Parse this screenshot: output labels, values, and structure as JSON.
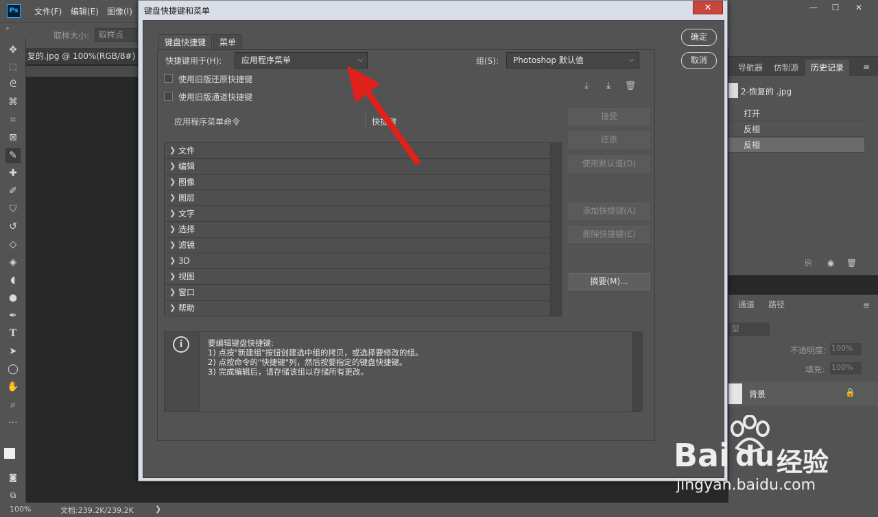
{
  "app": {
    "logo": "Ps",
    "menu": [
      "文件(F)",
      "编辑(E)",
      "图像(I)"
    ],
    "window_controls": {
      "min": "—",
      "max": "☐",
      "close": "✕"
    },
    "options": {
      "sample_size_label": "取样大小:",
      "sample_size_value": "取样点"
    },
    "doc_tab": "复的.jpg @ 100%(RGB/8#) *",
    "status": {
      "zoom": "100%",
      "doc": "文档:239.2K/239.2K",
      "arrow": "❯"
    }
  },
  "dialog": {
    "title": "键盘快捷键和菜单",
    "close": "✕",
    "tabs": [
      "键盘快捷键",
      "菜单"
    ],
    "shortcuts_for_label": "快捷键用于(H):",
    "shortcuts_for_value": "应用程序菜单",
    "set_label": "组(S):",
    "set_value": "Photoshop 默认值",
    "use_legacy_undo": "使用旧版还原快捷键",
    "use_legacy_channel": "使用旧版通道快捷键",
    "col_command": "应用程序菜单命令",
    "col_shortcut": "快捷键",
    "menu_rows": [
      "文件",
      "编辑",
      "图像",
      "图层",
      "文字",
      "选择",
      "滤镜",
      "3D",
      "视图",
      "窗口",
      "帮助"
    ],
    "buttons": {
      "ok": "确定",
      "cancel": "取消",
      "accept": "接受",
      "undo": "还原",
      "use_default": "使用默认值(D)",
      "add_shortcut": "添加快捷键(A)",
      "delete_shortcut": "删除快捷键(E)",
      "summarize": "摘要(M)..."
    },
    "info_icon": "i",
    "info_lines": [
      "要编辑键盘快捷键:",
      "1) 点按\"新建组\"按钮创建选中组的拷贝，或选择要修改的组。",
      "2) 点按命令的\"快捷键\"列，然后按要指定的键盘快捷键。",
      "3) 完成编辑后，请存储该组以存储所有更改。"
    ]
  },
  "panels": {
    "history_tabs": [
      "导航器",
      "仿制源",
      "历史记录"
    ],
    "history_snapshot": "2-恢复的 .jpg",
    "history_items": [
      "打开",
      "反相",
      "反相"
    ],
    "layers_tabs": [
      "通道",
      "路径"
    ],
    "layers_kind": "型",
    "opacity_label": "不透明度:",
    "opacity_value": "100%",
    "fill_label": "填充:",
    "fill_value": "100%",
    "layer_name": "背景"
  },
  "watermark": {
    "brand": "Bai",
    "brand2": "du",
    "cn": "经验",
    "url": "jingyan.baidu.com"
  },
  "colors": {
    "accent_red": "#e0201b",
    "panel": "#535353",
    "dark": "#282828"
  }
}
